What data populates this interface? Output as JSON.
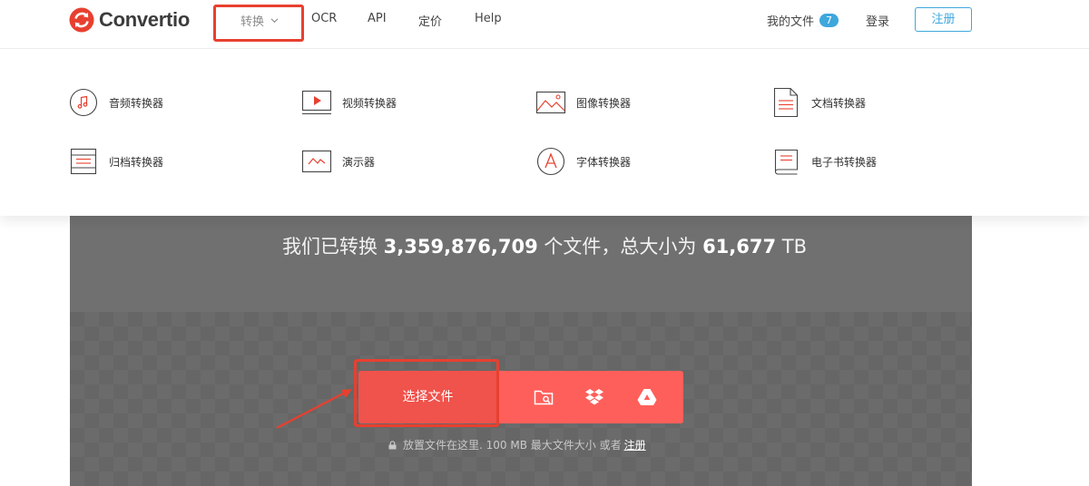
{
  "brand": {
    "name": "Convertio",
    "accent": "#e8402f"
  },
  "nav": {
    "convert": "转换",
    "ocr": "OCR",
    "api": "API",
    "pricing": "定价",
    "help": "Help"
  },
  "account": {
    "my_files": "我的文件",
    "file_count": "7",
    "login": "登录",
    "signup": "注册"
  },
  "menu": {
    "items": [
      {
        "label": "音频转换器",
        "icon": "music-note-icon"
      },
      {
        "label": "视频转换器",
        "icon": "video-play-icon"
      },
      {
        "label": "图像转换器",
        "icon": "image-icon"
      },
      {
        "label": "文档转换器",
        "icon": "document-icon"
      },
      {
        "label": "归档转换器",
        "icon": "archive-icon"
      },
      {
        "label": "演示器",
        "icon": "presentation-icon"
      },
      {
        "label": "字体转换器",
        "icon": "font-icon"
      },
      {
        "label": "电子书转换器",
        "icon": "ebook-icon"
      }
    ]
  },
  "stats": {
    "prefix": "我们已转换 ",
    "files_count": "3,359,876,709",
    "middle": " 个文件，总大小为 ",
    "total_size": "61,677",
    "unit": " TB"
  },
  "upload": {
    "choose_label": "选择文件",
    "icons": [
      "folder-search-icon",
      "dropbox-icon",
      "google-drive-icon"
    ],
    "note": "放置文件在这里. 100 MB 最大文件大小 或者",
    "note_link": "注册"
  }
}
